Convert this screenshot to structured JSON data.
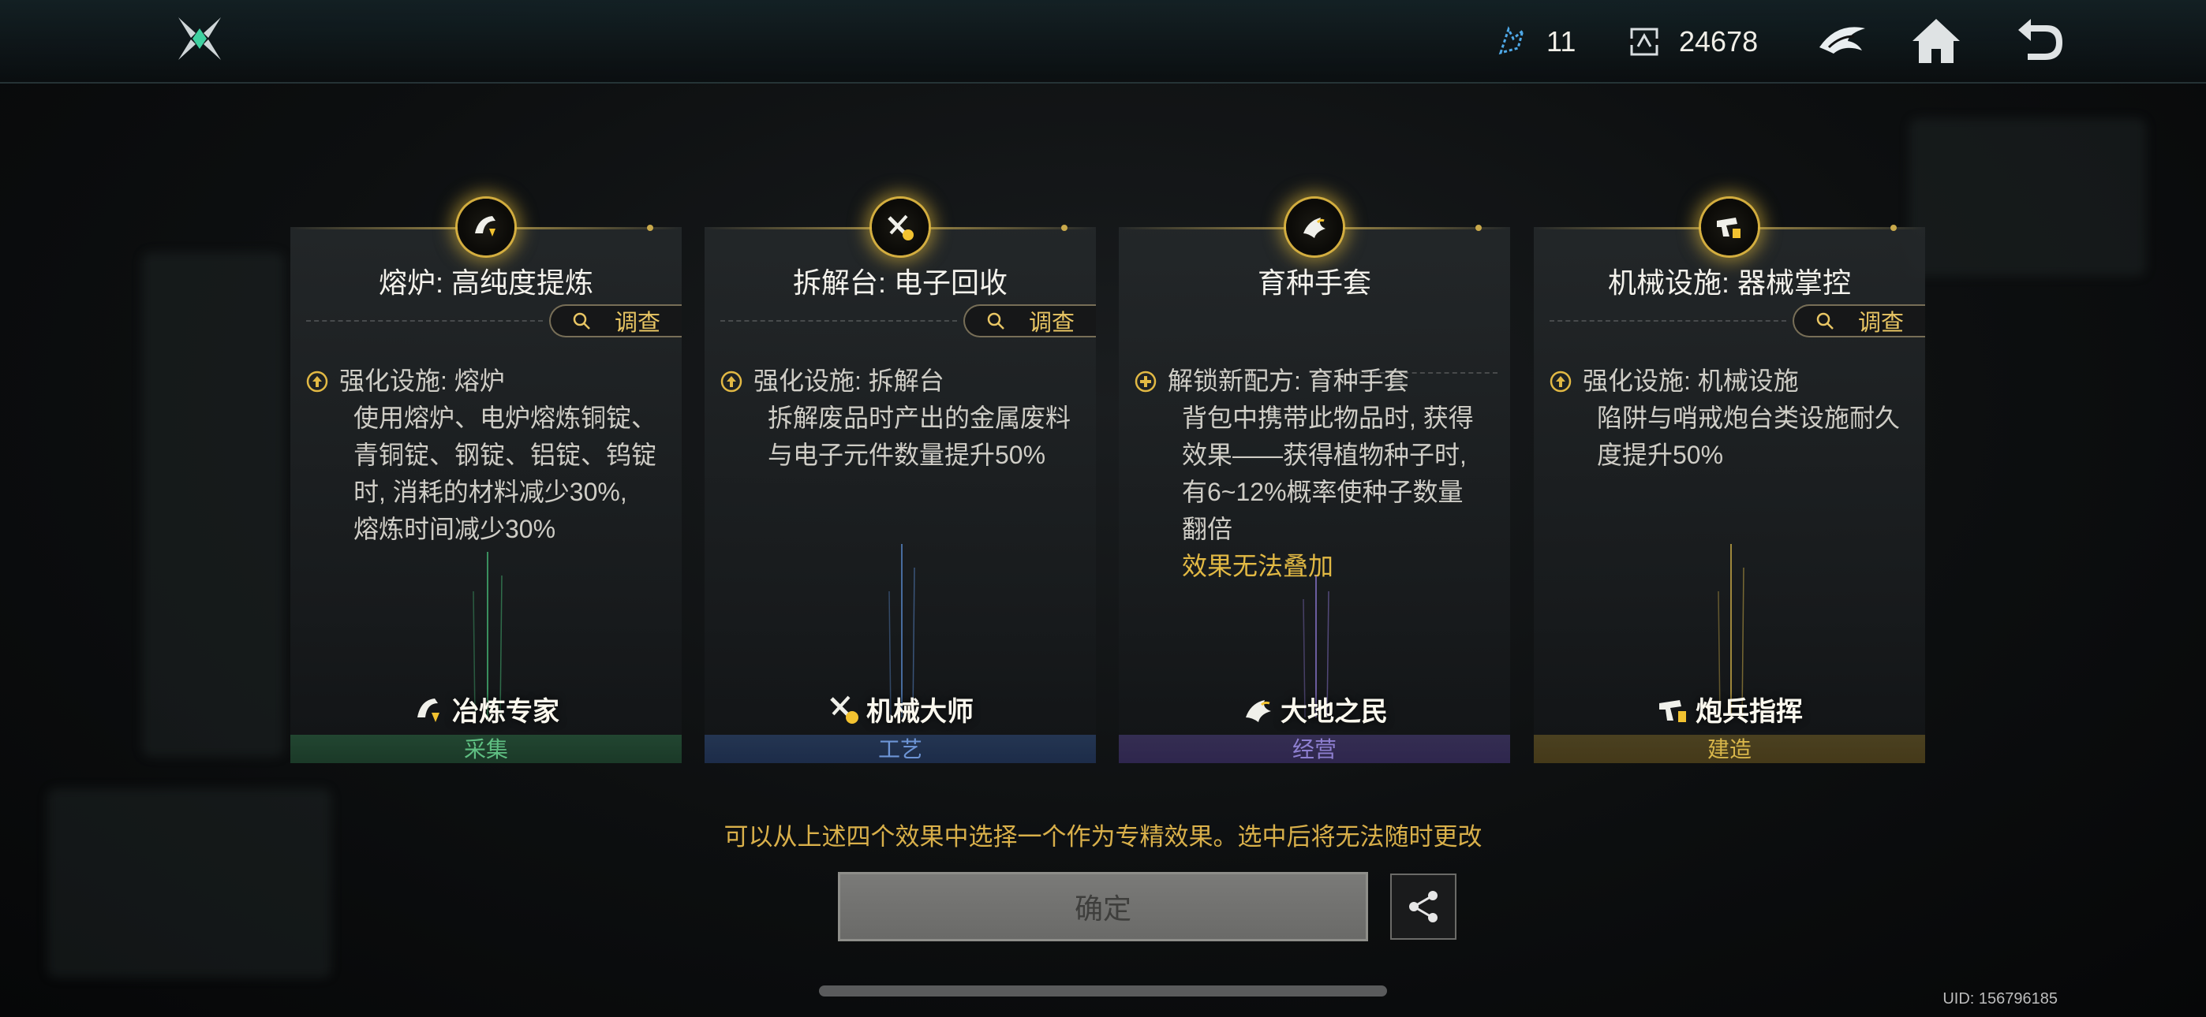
{
  "topbar": {
    "resources": [
      {
        "icon": "crystal-shard-icon",
        "value": "11"
      },
      {
        "icon": "exchange-token-icon",
        "value": "24678"
      }
    ],
    "buttons": [
      "faction-emblem-icon",
      "home-icon",
      "back-icon"
    ]
  },
  "cards": [
    {
      "title": "熔炉: 高纯度提炼",
      "investigate": "调查",
      "desc_head": "强化设施: 熔炉",
      "desc_lines": [
        "使用熔炉、电炉熔炼铜锭、",
        "青铜锭、钢锭、铝锭、钨锭",
        "时, 消耗的材料减少30%,",
        "熔炼时间减少30%"
      ],
      "warning": "",
      "specialty": "冶炼专家",
      "category": "采集",
      "accent": "#49c07a"
    },
    {
      "title": "拆解台: 电子回收",
      "investigate": "调查",
      "desc_head": "强化设施: 拆解台",
      "desc_lines": [
        "拆解废品时产出的金属废料",
        "与电子元件数量提升50%"
      ],
      "warning": "",
      "specialty": "机械大师",
      "category": "工艺",
      "accent": "#5d8fd6"
    },
    {
      "title": "育种手套",
      "investigate": "",
      "desc_head": "解锁新配方: 育种手套",
      "desc_lines": [
        "背包中携带此物品时, 获得",
        "效果——获得植物种子时,",
        "有6~12%概率使种子数量",
        "翻倍"
      ],
      "warning": "效果无法叠加",
      "specialty": "大地之民",
      "category": "经营",
      "accent": "#8f79d6"
    },
    {
      "title": "机械设施: 器械掌控",
      "investigate": "调查",
      "desc_head": "强化设施: 机械设施",
      "desc_lines": [
        "陷阱与哨戒炮台类设施耐久",
        "度提升50%"
      ],
      "warning": "",
      "specialty": "炮兵指挥",
      "category": "建造",
      "accent": "#d8b64a"
    }
  ],
  "hint": "可以从上述四个效果中选择一个作为专精效果。选中后将无法随时更改",
  "confirm_label": "确定",
  "uid": "UID: 156796185"
}
